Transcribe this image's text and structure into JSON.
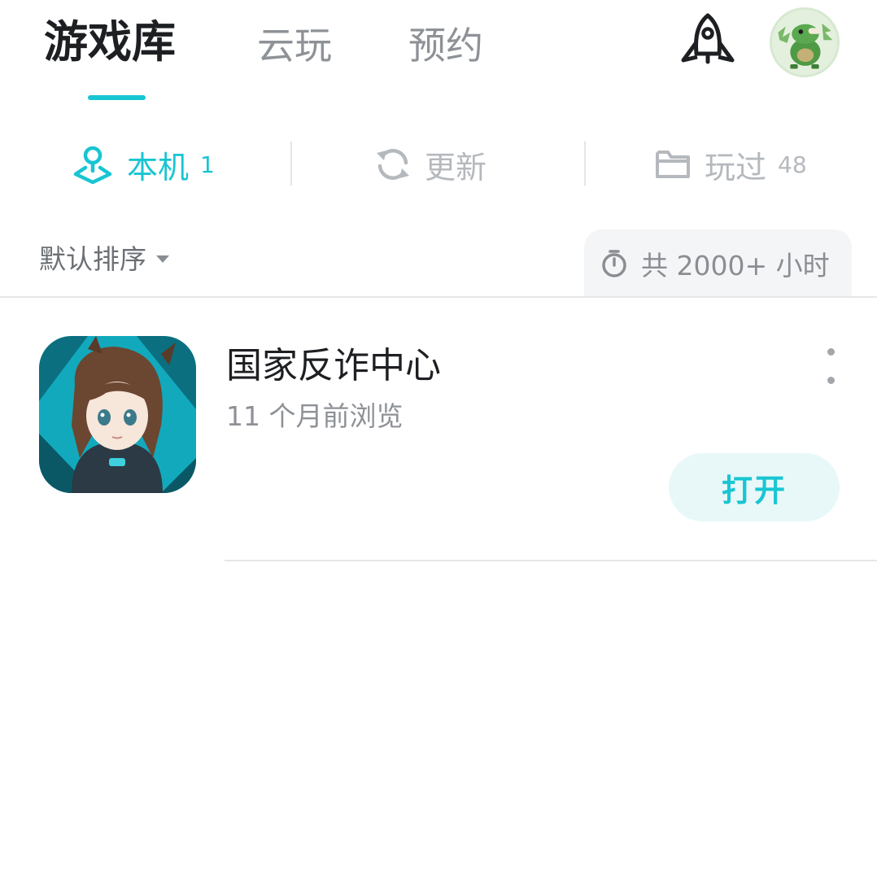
{
  "header": {
    "tabs": [
      {
        "label": "游戏库",
        "active": true
      },
      {
        "label": "云玩",
        "active": false
      },
      {
        "label": "预约",
        "active": false
      }
    ],
    "icons": {
      "launch": "rocket-icon",
      "profile": "avatar"
    }
  },
  "subtabs": {
    "local": {
      "label": "本机",
      "count": "1",
      "icon": "location-pin-icon"
    },
    "update": {
      "label": "更新",
      "icon": "refresh-icon"
    },
    "played": {
      "label": "玩过",
      "count": "48",
      "icon": "folder-icon"
    }
  },
  "sort": {
    "label": "默认排序"
  },
  "total_time": {
    "text": "共 2000+ 小时",
    "icon": "stopwatch-icon"
  },
  "games": [
    {
      "title": "国家反诈中心",
      "subtitle": "11 个月前浏览",
      "action_label": "打开"
    }
  ],
  "colors": {
    "accent": "#18c5d2",
    "accent_bg": "#e8f8f9",
    "muted": "#b5b9bd"
  }
}
